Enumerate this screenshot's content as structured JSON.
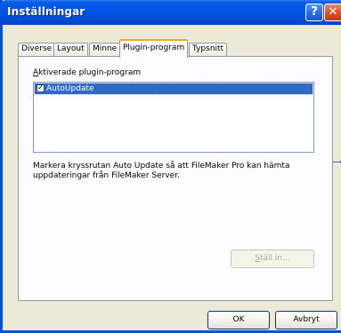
{
  "window": {
    "title": "Inställningar",
    "help_glyph": "?",
    "close_glyph": "✕"
  },
  "tabs": [
    {
      "label": "Diverse",
      "active": false
    },
    {
      "label": "Layout",
      "active": false
    },
    {
      "label": "Minne",
      "active": false
    },
    {
      "label": "Plugin-program",
      "active": true
    },
    {
      "label": "Typsnitt",
      "active": false
    }
  ],
  "plugins": {
    "group_label_first": "A",
    "group_label_rest": "ktiverade plugin-program",
    "items": [
      {
        "label": "AutoUpdate",
        "checked": true,
        "selected": true
      }
    ],
    "description": "Markera kryssrutan Auto Update så att FileMaker Pro kan hämta uppdateringar från FileMaker Server.",
    "configure_first": "S",
    "configure_rest": "täll in..."
  },
  "buttons": {
    "ok": "OK",
    "cancel": "Avbryt"
  },
  "colors": {
    "titlebar": "#0055e5",
    "selection": "#316ac5",
    "active_tab_accent": "#f5a623",
    "callout": "#2a6fc1"
  },
  "icons": {
    "help": "help-icon",
    "close": "close-icon",
    "check": "checkbox-checked-icon"
  }
}
